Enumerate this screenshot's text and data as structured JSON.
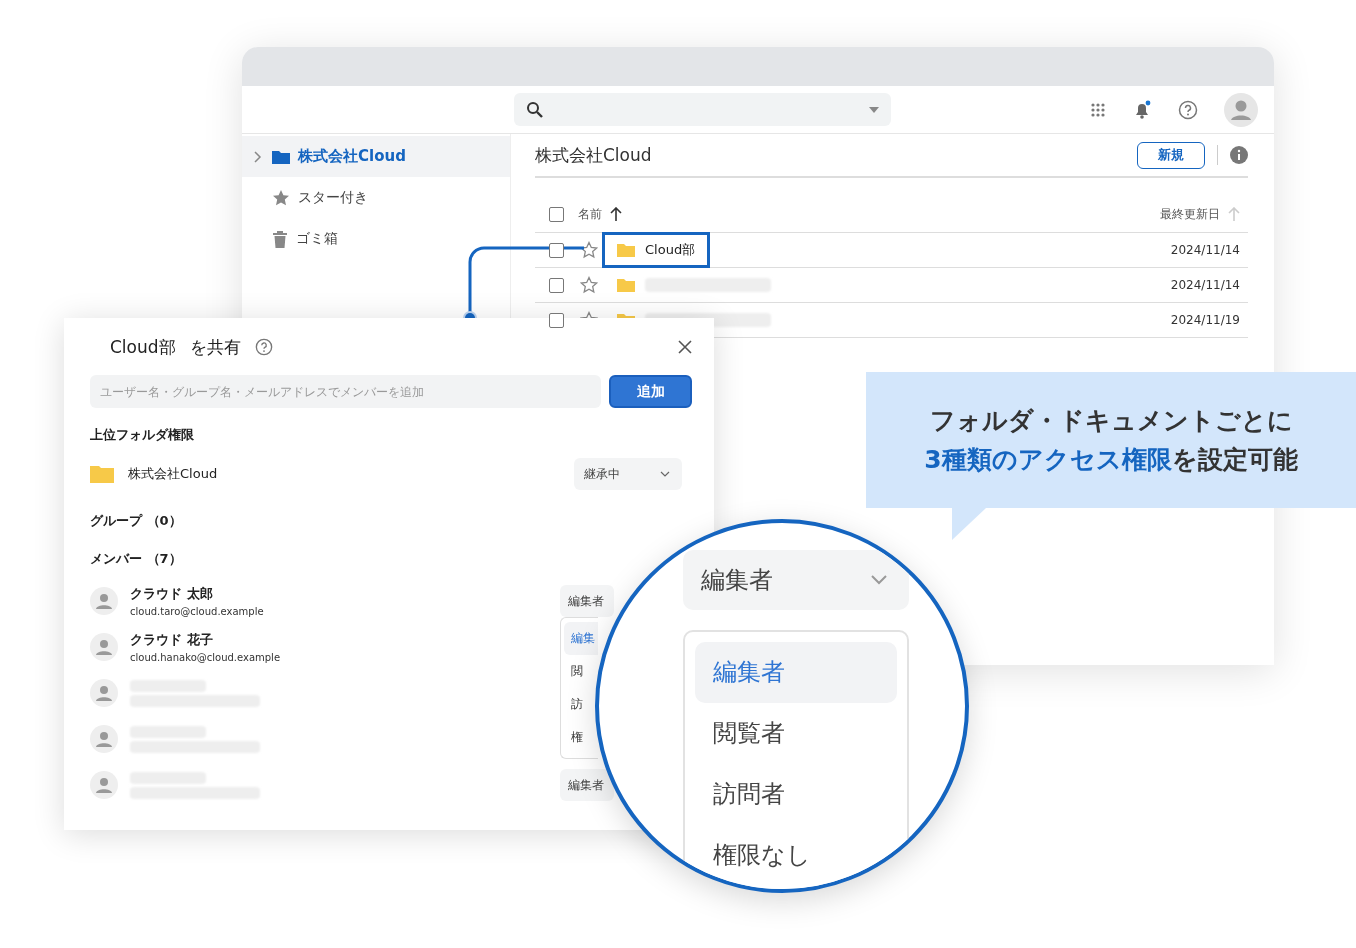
{
  "browser": {
    "sidebar": {
      "items": [
        {
          "label": "株式会社Cloud",
          "kind": "folder",
          "selected": true
        },
        {
          "label": "スター付き",
          "kind": "star",
          "selected": false
        },
        {
          "label": "ゴミ箱",
          "kind": "trash",
          "selected": false
        }
      ]
    },
    "breadcrumb": "株式会社Cloud",
    "new_button": "新規",
    "table": {
      "columns": [
        "名前",
        "最終更新日"
      ],
      "select_all_checked": false,
      "rows": [
        {
          "name": "Cloud部",
          "date": "2024/11/14",
          "highlighted": true,
          "checked": false
        },
        {
          "date": "2024/11/14",
          "highlighted": false,
          "checked": false
        },
        {
          "date": "2024/11/19",
          "highlighted": false,
          "checked": false
        }
      ]
    }
  },
  "dialog": {
    "title": "Cloud部",
    "title_suffix": "を共有",
    "search": {
      "placeholder": "ユーザー名・グループ名・メールアドレスでメンバーを追加"
    },
    "add_button": "追加",
    "parent_heading": "上位フォルダ権限",
    "parent_folder": "株式会社Cloud",
    "parent_select": "継承中",
    "groups_heading": "グループ （0）",
    "members_heading": "メンバー （7）",
    "members": [
      {
        "kind": "person",
        "name": "クラウド 太郎",
        "email": "cloud.taro@cloud.example",
        "role": "編集者"
      },
      {
        "kind": "person",
        "name": "クラウド 花子",
        "email": "cloud.hanako@cloud.example",
        "menu": [
          {
            "label": "編集",
            "selected": true
          },
          {
            "label": "閲",
            "selected": false
          },
          {
            "label": "訪",
            "selected": false
          },
          {
            "label": "権",
            "selected": false
          }
        ]
      },
      {
        "kind": "blurred"
      },
      {
        "kind": "blurred"
      },
      {
        "kind": "blurred",
        "role": "編集者"
      }
    ]
  },
  "callout": {
    "line1": "フォルダ・ドキュメントごとに",
    "line2_highlight": "3種類のアクセス権限",
    "line2_rest": "を設定可能"
  },
  "magnifier": {
    "select": "編集者",
    "options": [
      {
        "label": "編集者",
        "selected": true
      },
      {
        "label": "閲覧者",
        "selected": false
      },
      {
        "label": "訪問者",
        "selected": false
      },
      {
        "label": "権限なし",
        "selected": false
      }
    ]
  }
}
